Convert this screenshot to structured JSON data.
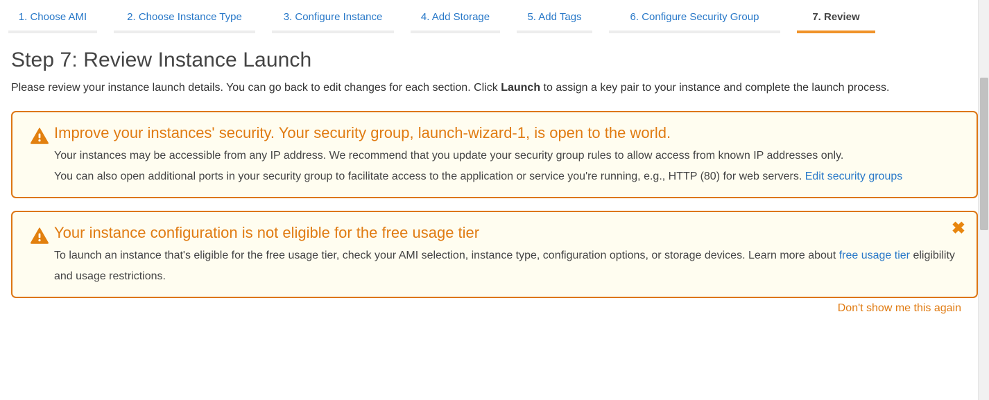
{
  "wizard": {
    "tabs": [
      {
        "label": "1. Choose AMI",
        "active": false
      },
      {
        "label": "2. Choose Instance Type",
        "active": false
      },
      {
        "label": "3. Configure Instance",
        "active": false
      },
      {
        "label": "4. Add Storage",
        "active": false
      },
      {
        "label": "5. Add Tags",
        "active": false
      },
      {
        "label": "6. Configure Security Group",
        "active": false
      },
      {
        "label": "7. Review",
        "active": true
      }
    ],
    "active_tab_index": 6,
    "active_underline_color": "#f0932a",
    "inactive_underline_color": "#ededed",
    "link_color": "#2878c8"
  },
  "page": {
    "heading": "Step 7: Review Instance Launch",
    "subtext_before": "Please review your instance launch details. You can go back to edit changes for each section. Click ",
    "subtext_bold": "Launch",
    "subtext_after": " to assign a key pair to your instance and complete the launch process."
  },
  "alerts": [
    {
      "icon": "warning-triangle-icon",
      "title": "Improve your instances' security. Your security group, launch-wizard-1, is open to the world.",
      "paragraph_1": "Your instances may be accessible from any IP address. We recommend that you update your security group rules to allow access from known IP addresses only.",
      "paragraph_2_before": "You can also open additional ports in your security group to facilitate access to the application or service you're running, e.g., HTTP (80) for web servers. ",
      "link_text": "Edit security groups",
      "paragraph_2_after": "",
      "has_close": false,
      "border_color": "#dd7613",
      "background_color": "#fffdf0",
      "title_color": "#e07b12"
    },
    {
      "icon": "warning-triangle-icon",
      "title": "Your instance configuration is not eligible for the free usage tier",
      "paragraph_1": "",
      "paragraph_2_before": "To launch an instance that's eligible for the free usage tier, check your AMI selection, instance type, configuration options, or storage devices. Learn more about ",
      "link_text": "free usage tier",
      "paragraph_2_after": " eligibility and usage restrictions.",
      "has_close": true,
      "close_label": "✖",
      "dismiss_label": "Don't show me this again",
      "border_color": "#dd7613",
      "background_color": "#fffdf0",
      "title_color": "#e07b12"
    }
  ]
}
